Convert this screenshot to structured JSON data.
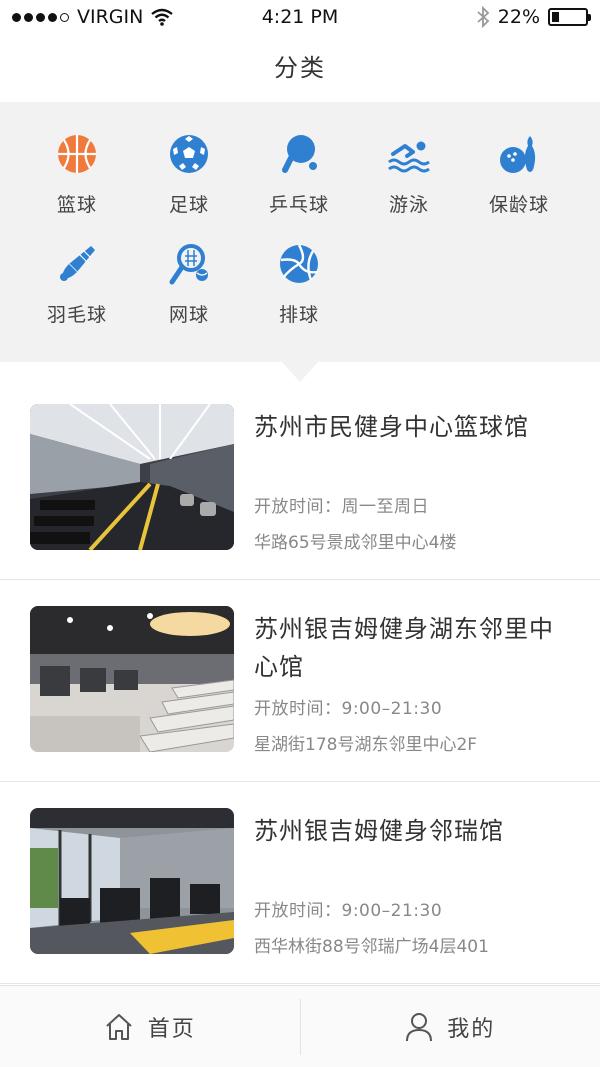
{
  "status_bar": {
    "carrier": "VIRGIN",
    "time": "4:21 PM",
    "battery_text": "22%",
    "battery_level": 0.22
  },
  "header": {
    "title": "分类"
  },
  "categories": [
    {
      "label": "篮球",
      "icon": "basketball-icon"
    },
    {
      "label": "足球",
      "icon": "soccer-ball-icon"
    },
    {
      "label": "乒乓球",
      "icon": "ping-pong-icon"
    },
    {
      "label": "游泳",
      "icon": "swimming-icon"
    },
    {
      "label": "保龄球",
      "icon": "bowling-icon"
    },
    {
      "label": "羽毛球",
      "icon": "badminton-icon"
    },
    {
      "label": "网球",
      "icon": "tennis-icon"
    },
    {
      "label": "排球",
      "icon": "volleyball-icon"
    }
  ],
  "venues": [
    {
      "name": "苏州市民健身中心篮球馆",
      "hours": "开放时间：周一至周日",
      "address": "华路65号景成邻里中心4楼"
    },
    {
      "name": "苏州银吉姆健身湖东邻里中心馆",
      "hours": "开放时间：9:00–21:30",
      "address": "星湖街178号湖东邻里中心2F"
    },
    {
      "name": "苏州银吉姆健身邻瑞馆",
      "hours": "开放时间：9:00–21:30",
      "address": "西华林街88号邻瑞广场4层401"
    }
  ],
  "tab_bar": {
    "home_label": "首页",
    "home_icon": "home-icon",
    "me_label": "我的",
    "me_icon": "user-icon"
  },
  "colors": {
    "accent": "#2f80d1",
    "panel_bg": "#f2f2f2"
  }
}
